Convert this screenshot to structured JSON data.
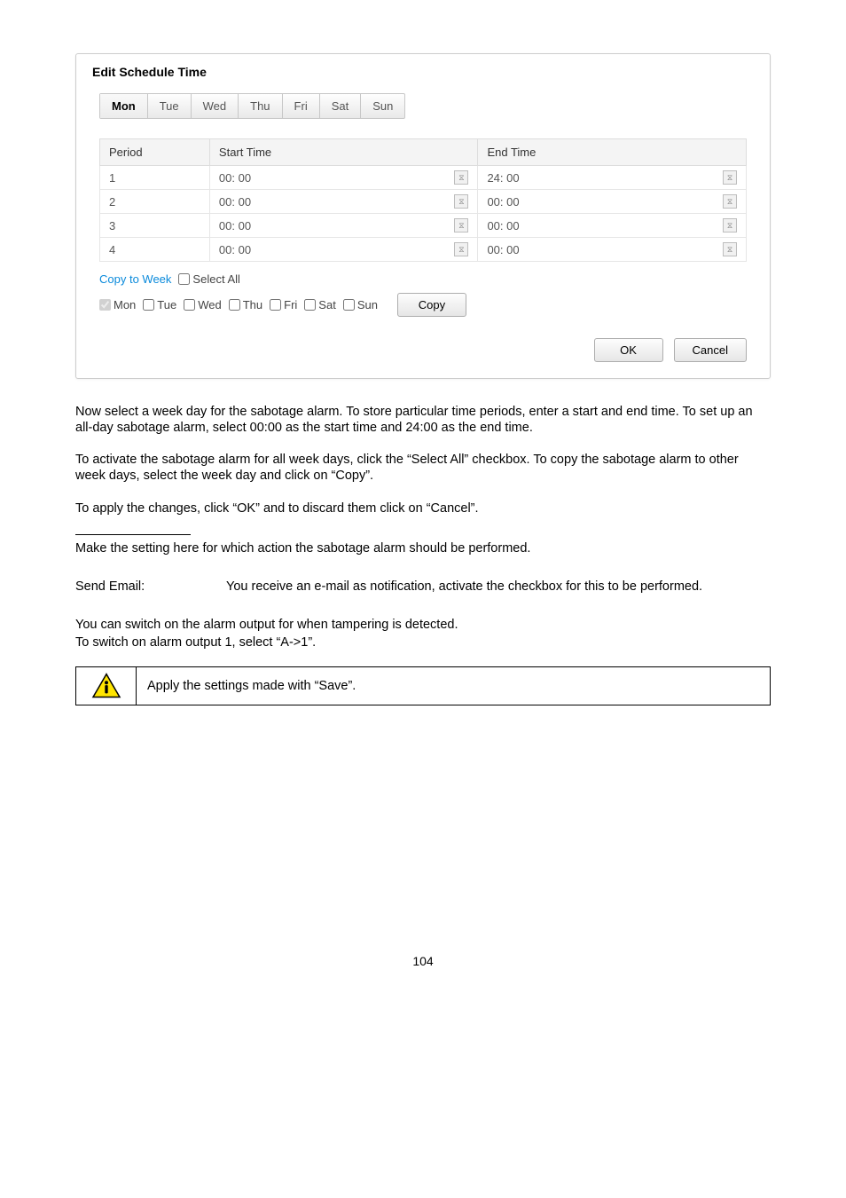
{
  "dialog": {
    "title": "Edit Schedule Time",
    "tabs": [
      "Mon",
      "Tue",
      "Wed",
      "Thu",
      "Fri",
      "Sat",
      "Sun"
    ],
    "active_tab": "Mon",
    "headers": {
      "period": "Period",
      "start": "Start Time",
      "end": "End Time"
    },
    "rows": [
      {
        "period": "1",
        "start": "00: 00",
        "end": "24: 00"
      },
      {
        "period": "2",
        "start": "00: 00",
        "end": "00: 00"
      },
      {
        "period": "3",
        "start": "00: 00",
        "end": "00: 00"
      },
      {
        "period": "4",
        "start": "00: 00",
        "end": "00: 00"
      }
    ],
    "copy_to_week": "Copy to Week",
    "select_all": "Select All",
    "days": [
      {
        "label": "Mon",
        "checked": true,
        "disabled": true
      },
      {
        "label": "Tue",
        "checked": false,
        "disabled": false
      },
      {
        "label": "Wed",
        "checked": false,
        "disabled": false
      },
      {
        "label": "Thu",
        "checked": false,
        "disabled": false
      },
      {
        "label": "Fri",
        "checked": false,
        "disabled": false
      },
      {
        "label": "Sat",
        "checked": false,
        "disabled": false
      },
      {
        "label": "Sun",
        "checked": false,
        "disabled": false
      }
    ],
    "copy_button": "Copy",
    "ok": "OK",
    "cancel": "Cancel"
  },
  "paragraphs": {
    "p1": "Now select a week day for the sabotage alarm. To store particular time periods, enter a start and end time. To set up an all-day sabotage alarm, select 00:00 as the start time and 24:00 as the end time.",
    "p2": "To activate the sabotage alarm for all week days, click the “Select All” checkbox. To copy the sabotage alarm to other week days, select the week day and click on “Copy”.",
    "p3": "To apply the changes, click “OK” and to discard them click on “Cancel”.",
    "p4": "Make the setting here for which action the sabotage alarm should be performed.",
    "send_label": "Send Email:",
    "send_text": "You receive an e-mail as notification, activate the checkbox for this to be performed.",
    "p5a": "You can switch on the alarm output for when tampering is detected.",
    "p5b": "To switch on alarm output 1, select “A->1”.",
    "info": "Apply the settings made with “Save”."
  },
  "page_number": "104"
}
